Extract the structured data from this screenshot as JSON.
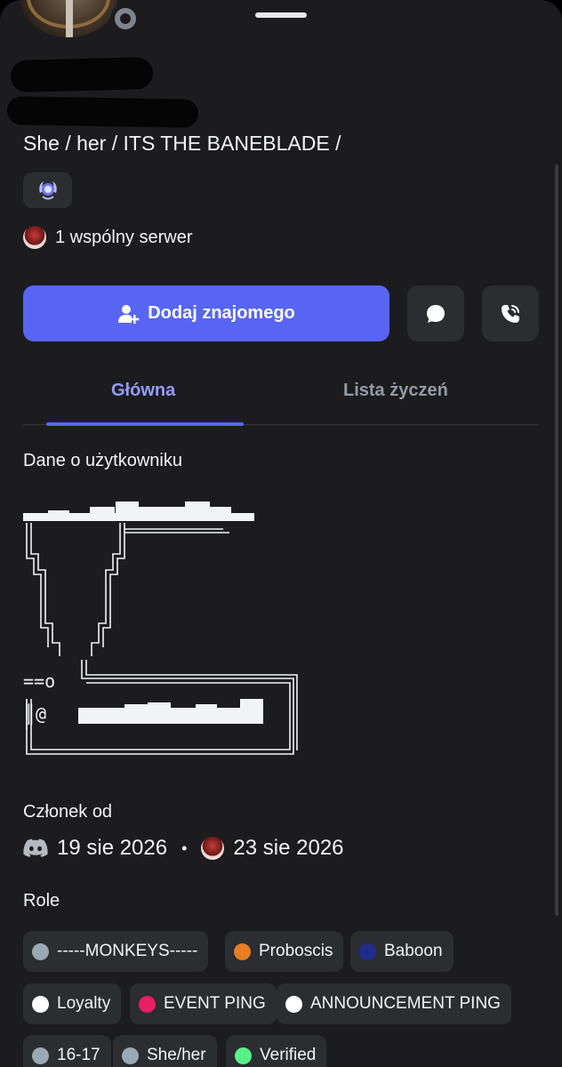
{
  "profile": {
    "pronouns": "She / her / ITS THE BANEBLADE /",
    "mutual_servers": "1 wspólny serwer"
  },
  "actions": {
    "add_friend": "Dodaj znajomego"
  },
  "tabs": [
    {
      "label": "Główna",
      "active": true
    },
    {
      "label": "Lista życzeń",
      "active": false
    }
  ],
  "sections": {
    "about_title": "Dane o użytkowniku",
    "about_text": "==o\n║@",
    "member_since_title": "Członek od",
    "discord_date": "19 sie 2026",
    "separator": "•",
    "server_date": "23 sie 2026",
    "roles_title": "Role"
  },
  "roles": [
    {
      "name": "-----MONKEYS-----",
      "color": "#99aab5"
    },
    {
      "name": "Proboscis",
      "color": "#e67e22"
    },
    {
      "name": "Baboon",
      "color": "#1f2e8c"
    },
    {
      "name": "Loyalty",
      "color": "#ffffff"
    },
    {
      "name": "EVENT PING",
      "color": "#e91e63"
    },
    {
      "name": "ANNOUNCEMENT PING",
      "color": "#ffffff"
    },
    {
      "name": "16-17",
      "color": "#99aab5"
    },
    {
      "name": "She/her",
      "color": "#99aab5"
    },
    {
      "name": "Verified",
      "color": "#57f287"
    }
  ],
  "colors": {
    "accent": "#5865f2",
    "active_tab": "#949cf7",
    "surface": "#2b2d31",
    "background": "#1c1c1f"
  },
  "icons": [
    "add-friend-icon",
    "message-icon",
    "phone-icon",
    "nitro-badge-icon",
    "discord-icon"
  ]
}
